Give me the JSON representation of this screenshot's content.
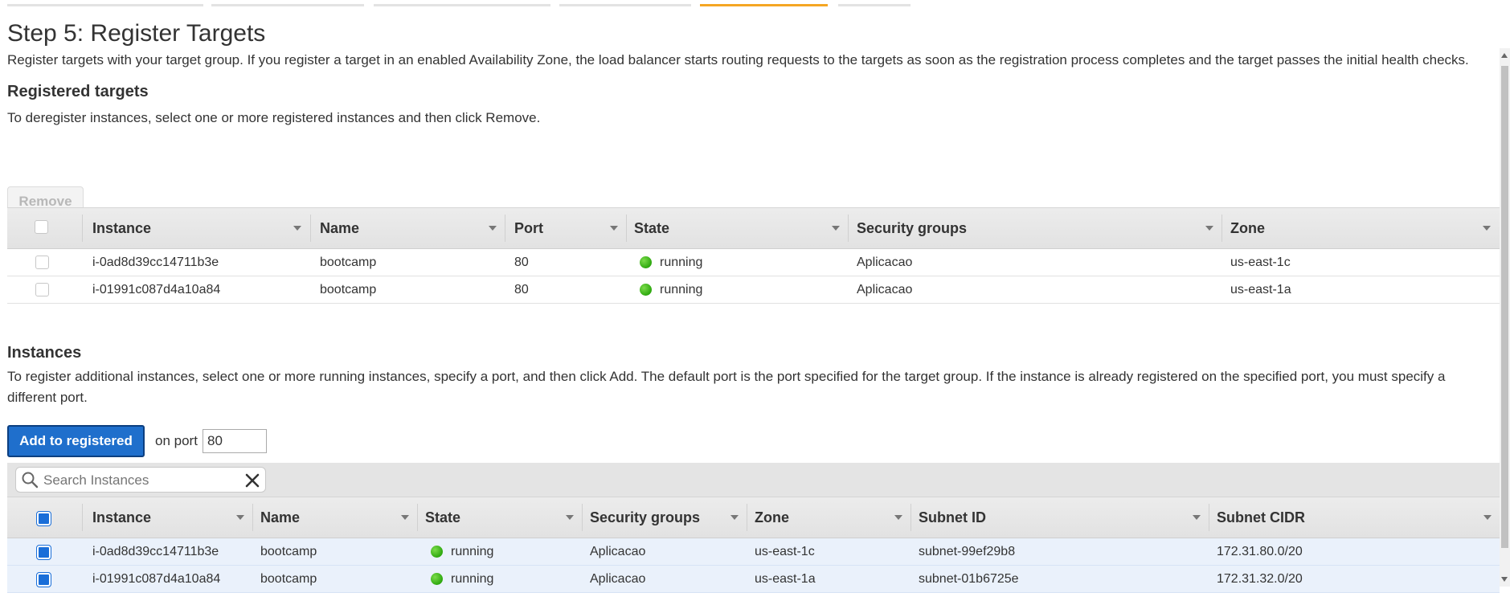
{
  "wizard": {
    "steps": 6,
    "active_step": 5
  },
  "header": {
    "title": "Step 5: Register Targets",
    "description": "Register targets with your target group. If you register a target in an enabled Availability Zone, the load balancer starts routing requests to the targets as soon as the registration process completes and the target passes the initial health checks."
  },
  "registered": {
    "heading": "Registered targets",
    "help": "To deregister instances, select one or more registered instances and then click Remove.",
    "remove_label": "Remove",
    "columns": [
      "Instance",
      "Name",
      "Port",
      "State",
      "Security groups",
      "Zone"
    ],
    "rows": [
      {
        "instance": "i-0ad8d39cc14711b3e",
        "name": "bootcamp",
        "port": "80",
        "state": "running",
        "security_groups": "Aplicacao",
        "zone": "us-east-1c"
      },
      {
        "instance": "i-01991c087d4a10a84",
        "name": "bootcamp",
        "port": "80",
        "state": "running",
        "security_groups": "Aplicacao",
        "zone": "us-east-1a"
      }
    ]
  },
  "instances": {
    "heading": "Instances",
    "help": "To register additional instances, select one or more running instances, specify a port, and then click Add. The default port is the port specified for the target group. If the instance is already registered on the specified port, you must specify a different port.",
    "add_label": "Add to registered",
    "on_port_label": "on port",
    "port_value": "80",
    "search_placeholder": "Search Instances",
    "columns": [
      "Instance",
      "Name",
      "State",
      "Security groups",
      "Zone",
      "Subnet ID",
      "Subnet CIDR"
    ],
    "rows": [
      {
        "instance": "i-0ad8d39cc14711b3e",
        "name": "bootcamp",
        "state": "running",
        "security_groups": "Aplicacao",
        "zone": "us-east-1c",
        "subnet_id": "subnet-99ef29b8",
        "subnet_cidr": "172.31.80.0/20",
        "checked": true
      },
      {
        "instance": "i-01991c087d4a10a84",
        "name": "bootcamp",
        "state": "running",
        "security_groups": "Aplicacao",
        "zone": "us-east-1a",
        "subnet_id": "subnet-01b6725e",
        "subnet_cidr": "172.31.32.0/20",
        "checked": true
      }
    ]
  },
  "colors": {
    "accent": "#f5a623",
    "primary_button": "#1f6fcc",
    "status_running": "#2ea80f",
    "selected_row": "#eaf1fb"
  },
  "icons": {
    "search": "search-icon",
    "clear": "close-icon",
    "status": "status-dot-icon",
    "sort": "sort-caret-icon"
  }
}
